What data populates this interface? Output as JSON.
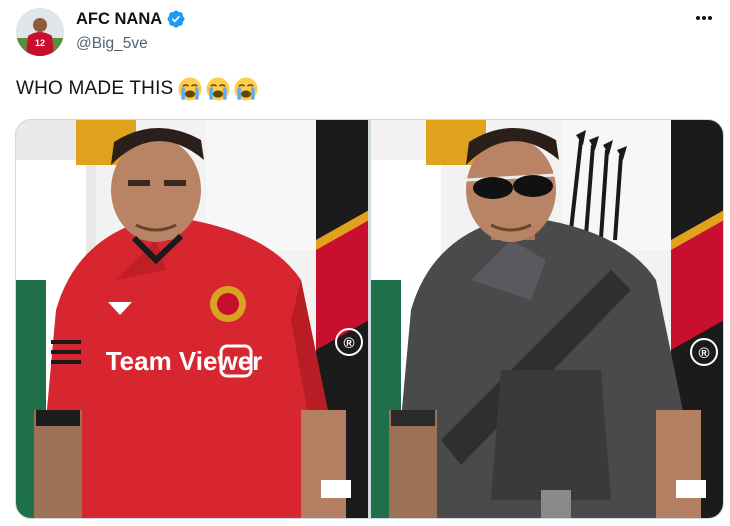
{
  "account": {
    "display_name": "AFC NANA",
    "handle": "@Big_5ve",
    "verified": true,
    "avatar": "avatar-image",
    "verified_icon": "verified-badge-icon",
    "more_icon": "more-options-icon"
  },
  "tweet": {
    "text": "WHO MADE THIS",
    "emojis": [
      "loudly-crying-face",
      "loudly-crying-face",
      "loudly-crying-face"
    ]
  },
  "media": {
    "photos": [
      {
        "id": "original",
        "shirt_text": "Team Viewer",
        "registered_mark": "®"
      },
      {
        "id": "edited",
        "registered_mark": "®"
      }
    ]
  },
  "colors": {
    "verified_blue": "#1d9bf0",
    "handle_gray": "#536471",
    "shirt_red": "#d7262f"
  }
}
